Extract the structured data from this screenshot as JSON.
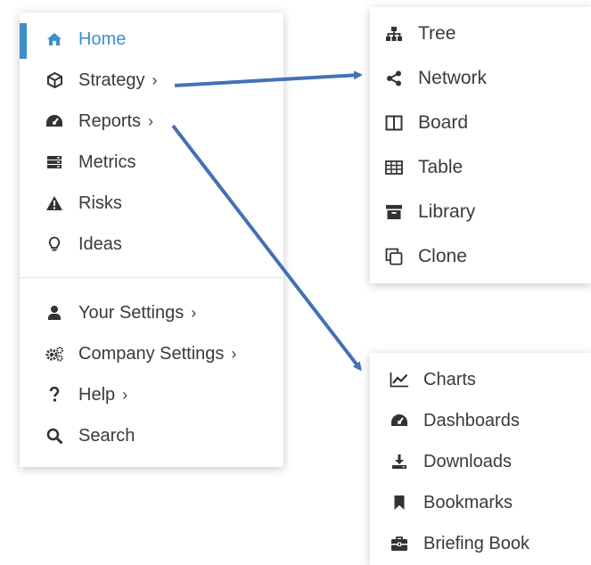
{
  "main_menu": {
    "items": [
      {
        "label": "Home",
        "icon": "home-icon",
        "has_submenu": false,
        "active": true
      },
      {
        "label": "Strategy",
        "icon": "cube-icon",
        "has_submenu": true
      },
      {
        "label": "Reports",
        "icon": "dashboard-icon",
        "has_submenu": true
      },
      {
        "label": "Metrics",
        "icon": "server-icon",
        "has_submenu": false
      },
      {
        "label": "Risks",
        "icon": "warning-icon",
        "has_submenu": false
      },
      {
        "label": "Ideas",
        "icon": "lightbulb-icon",
        "has_submenu": false
      },
      {
        "label": "Your Settings",
        "icon": "user-icon",
        "has_submenu": true
      },
      {
        "label": "Company Settings",
        "icon": "cogs-icon",
        "has_submenu": true
      },
      {
        "label": "Help",
        "icon": "question-icon",
        "has_submenu": true
      },
      {
        "label": "Search",
        "icon": "search-icon",
        "has_submenu": false
      }
    ],
    "chevron": "›"
  },
  "strategy_submenu": {
    "items": [
      {
        "label": "Tree",
        "icon": "sitemap-icon"
      },
      {
        "label": "Network",
        "icon": "share-icon"
      },
      {
        "label": "Board",
        "icon": "columns-icon"
      },
      {
        "label": "Table",
        "icon": "table-icon"
      },
      {
        "label": "Library",
        "icon": "archive-icon"
      },
      {
        "label": "Clone",
        "icon": "clone-icon"
      }
    ]
  },
  "reports_submenu": {
    "items": [
      {
        "label": "Charts",
        "icon": "line-chart-icon"
      },
      {
        "label": "Dashboards",
        "icon": "dashboard-icon"
      },
      {
        "label": "Downloads",
        "icon": "download-icon"
      },
      {
        "label": "Bookmarks",
        "icon": "bookmark-icon"
      },
      {
        "label": "Briefing Book",
        "icon": "briefcase-icon"
      }
    ]
  },
  "colors": {
    "accent": "#3d8fc9",
    "text": "#3a3a3a",
    "arrow": "#4472b4"
  }
}
